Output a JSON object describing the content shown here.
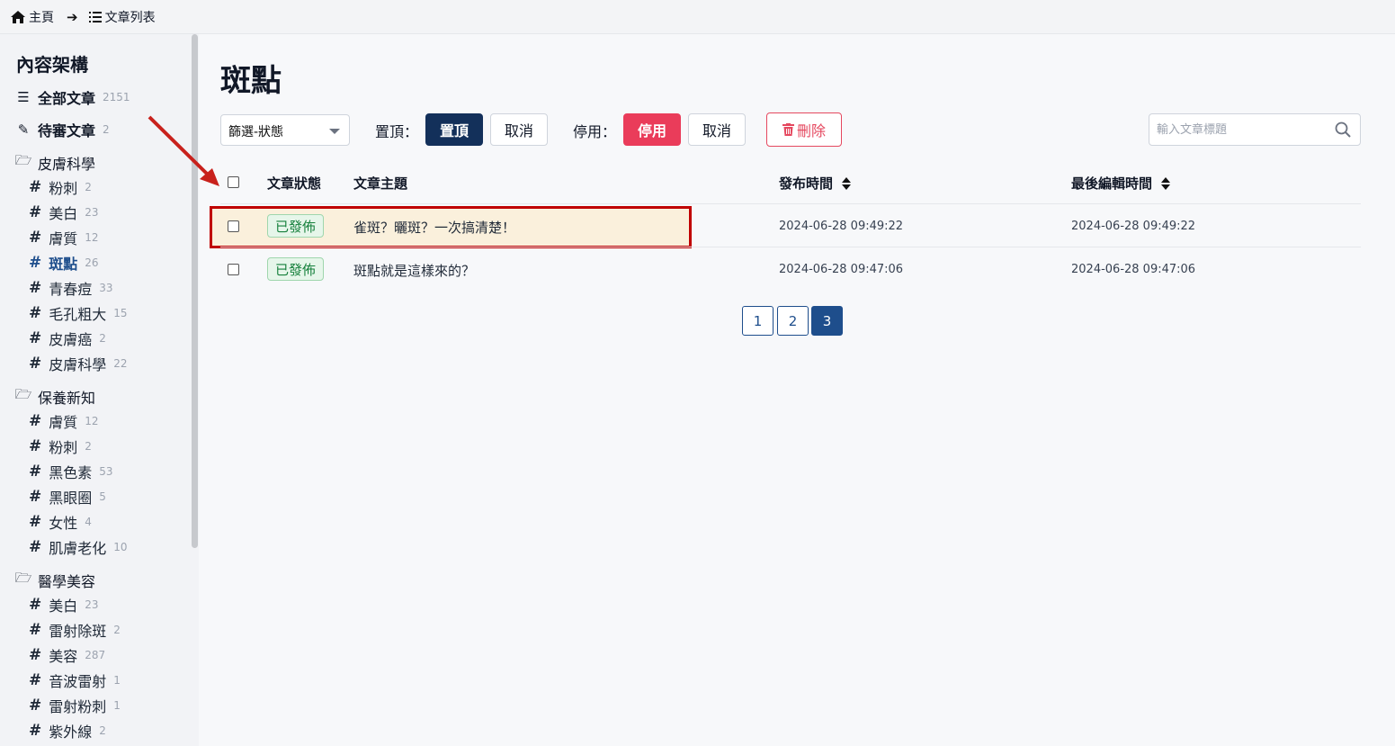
{
  "breadcrumb": {
    "home": "主頁",
    "list": "文章列表"
  },
  "sidebar": {
    "title": "內容架構",
    "all": {
      "label": "全部文章",
      "count": "2151"
    },
    "pending": {
      "label": "待審文章",
      "count": "2"
    },
    "categories": [
      {
        "label": "皮膚科學",
        "tags": [
          {
            "label": "粉刺",
            "count": "2"
          },
          {
            "label": "美白",
            "count": "23"
          },
          {
            "label": "膚質",
            "count": "12"
          },
          {
            "label": "斑點",
            "count": "26"
          },
          {
            "label": "青春痘",
            "count": "33"
          },
          {
            "label": "毛孔粗大",
            "count": "15"
          },
          {
            "label": "皮膚癌",
            "count": "2"
          },
          {
            "label": "皮膚科學",
            "count": "22"
          }
        ]
      },
      {
        "label": "保養新知",
        "tags": [
          {
            "label": "膚質",
            "count": "12"
          },
          {
            "label": "粉刺",
            "count": "2"
          },
          {
            "label": "黑色素",
            "count": "53"
          },
          {
            "label": "黑眼圈",
            "count": "5"
          },
          {
            "label": "女性",
            "count": "4"
          },
          {
            "label": "肌膚老化",
            "count": "10"
          }
        ]
      },
      {
        "label": "醫學美容",
        "tags": [
          {
            "label": "美白",
            "count": "23"
          },
          {
            "label": "雷射除斑",
            "count": "2"
          },
          {
            "label": "美容",
            "count": "287"
          },
          {
            "label": "音波雷射",
            "count": "1"
          },
          {
            "label": "雷射粉刺",
            "count": "1"
          },
          {
            "label": "紫外線",
            "count": "2"
          }
        ]
      }
    ]
  },
  "main": {
    "title": "斑點",
    "filter_value": "篩選-狀態",
    "pin_label": "置頂：",
    "pin_button": "置頂",
    "pin_cancel": "取消",
    "disable_label": "停用：",
    "disable_button": "停用",
    "disable_cancel": "取消",
    "delete_button": "刪除",
    "search_placeholder": "輸入文章標題"
  },
  "table": {
    "headers": {
      "status": "文章狀態",
      "subject": "文章主題",
      "published": "發布時間",
      "edited": "最後編輯時間"
    },
    "rows": [
      {
        "status": "已發佈",
        "subject": "雀斑？曬斑？一次搞清楚！",
        "published": "2024-06-28 09:49:22",
        "edited": "2024-06-28 09:49:22"
      },
      {
        "status": "已發佈",
        "subject": "斑點就是這樣來的？",
        "published": "2024-06-28 09:47:06",
        "edited": "2024-06-28 09:47:06"
      }
    ]
  },
  "pagination": {
    "pages": [
      "1",
      "2",
      "3"
    ],
    "current": "3"
  },
  "colors": {
    "primary": "#1e4e8c",
    "dark_button": "#13305a",
    "danger": "#ea3c5a",
    "success_bg": "#e6f6ea",
    "highlight_border": "#c00000"
  }
}
